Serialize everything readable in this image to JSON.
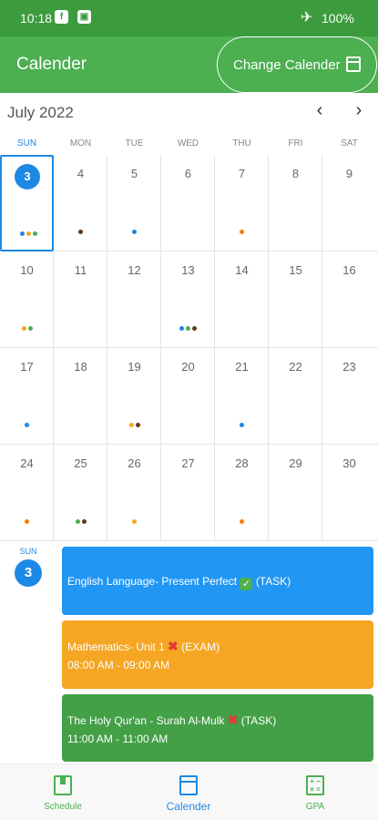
{
  "status_bar": {
    "time": "10:18",
    "battery": "100%"
  },
  "app_bar": {
    "title": "Calender",
    "change_button": "Change Calender"
  },
  "calendar": {
    "month": "July 2022",
    "weekdays": [
      "SUN",
      "MON",
      "TUE",
      "WED",
      "THU",
      "FRI",
      "SAT"
    ],
    "selected_day": 3,
    "days": [
      {
        "n": "3",
        "dots": [
          "#1e88e5",
          "#f5a623",
          "#4caf50"
        ]
      },
      {
        "n": "4",
        "dots": [
          "#5d3a1a"
        ]
      },
      {
        "n": "5",
        "dots": [
          "#1e88e5"
        ]
      },
      {
        "n": "6",
        "dots": []
      },
      {
        "n": "7",
        "dots": [
          "#f57c00"
        ]
      },
      {
        "n": "8",
        "dots": []
      },
      {
        "n": "9",
        "dots": []
      },
      {
        "n": "10",
        "dots": [
          "#f5a623",
          "#4caf50"
        ]
      },
      {
        "n": "11",
        "dots": []
      },
      {
        "n": "12",
        "dots": []
      },
      {
        "n": "13",
        "dots": [
          "#1e88e5",
          "#4caf50",
          "#5d3a1a"
        ]
      },
      {
        "n": "14",
        "dots": []
      },
      {
        "n": "15",
        "dots": []
      },
      {
        "n": "16",
        "dots": []
      },
      {
        "n": "17",
        "dots": [
          "#1e88e5"
        ]
      },
      {
        "n": "18",
        "dots": []
      },
      {
        "n": "19",
        "dots": [
          "#f5a623",
          "#5d3a1a"
        ]
      },
      {
        "n": "20",
        "dots": []
      },
      {
        "n": "21",
        "dots": [
          "#1e88e5"
        ]
      },
      {
        "n": "22",
        "dots": []
      },
      {
        "n": "23",
        "dots": []
      },
      {
        "n": "24",
        "dots": [
          "#f57c00"
        ]
      },
      {
        "n": "25",
        "dots": [
          "#4caf50",
          "#5d3a1a"
        ]
      },
      {
        "n": "26",
        "dots": [
          "#f5a623"
        ]
      },
      {
        "n": "27",
        "dots": []
      },
      {
        "n": "28",
        "dots": [
          "#f57c00"
        ]
      },
      {
        "n": "29",
        "dots": []
      },
      {
        "n": "30",
        "dots": []
      }
    ]
  },
  "selected": {
    "day_name": "SUN",
    "day_number": "3"
  },
  "events": [
    {
      "title": "English Language- Present Perfect",
      "status": "done",
      "tag": "(TASK)",
      "time": "",
      "color": "#2196f3"
    },
    {
      "title": "Mathematics- Unit 1",
      "status": "missed",
      "tag": "(EXAM)",
      "time": "08:00 AM - 09:00 AM",
      "color": "#f5a623"
    },
    {
      "title": "The Holy Qur'an - Surah Al-Mulk",
      "status": "missed",
      "tag": "(TASK)",
      "time": "11:00 AM - 11:00 AM",
      "color": "#43a047"
    }
  ],
  "bottom_nav": {
    "tabs": [
      {
        "label": "Schedule",
        "icon": "book-icon",
        "active": false
      },
      {
        "label": "Calender",
        "icon": "calendar-icon",
        "active": true
      },
      {
        "label": "GPA",
        "icon": "calculator-icon",
        "active": false
      }
    ]
  },
  "colors": {
    "primary_green": "#4caf50",
    "status_green": "#3c9b3c",
    "accent_blue": "#1e88e5"
  }
}
